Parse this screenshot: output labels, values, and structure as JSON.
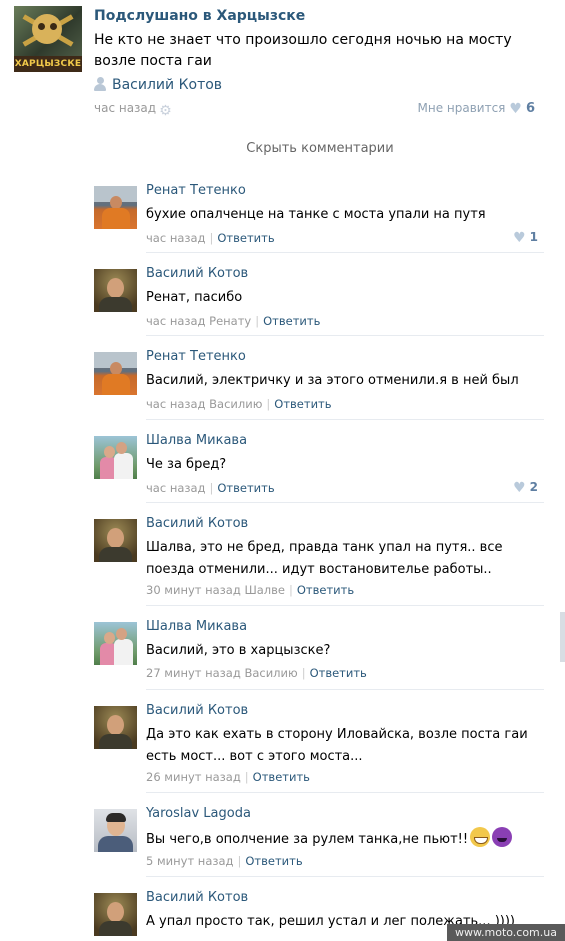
{
  "post": {
    "group_name": "Подслушано в Харцызске",
    "group_avatar_label": "ХАРЦЫЗСКЕ",
    "text": "Не кто не знает что произошло сегодня ночью на мосту возле поста гаи",
    "author": "Василий Котов",
    "time": "час назад",
    "like_label": "Мне нравится",
    "like_count": "6"
  },
  "hide_comments": "Скрыть комментарии",
  "comments": [
    {
      "name": "Ренат Тетенко",
      "text": "бухие опалченце на танке с моста упали на путя",
      "time": "час назад",
      "reply": "Ответить",
      "likes": "1"
    },
    {
      "name": "Василий Котов",
      "text": "Ренат, пасибо",
      "time": "час назад Ренату",
      "reply": "Ответить"
    },
    {
      "name": "Ренат Тетенко",
      "text": "Василий, электричку и за этого отменили.я в ней был",
      "time": "час назад Василию",
      "reply": "Ответить"
    },
    {
      "name": "Шалва Микава",
      "text": "Че за бред?",
      "time": "час назад",
      "reply": "Ответить",
      "likes": "2"
    },
    {
      "name": "Василий Котов",
      "text": "Шалва, это не бред, правда танк упал на путя.. все поезда отменили... идут востановителье работы..",
      "time": "30 минут назад Шалве",
      "reply": "Ответить"
    },
    {
      "name": "Шалва Микава",
      "text": "Василий, это в харцызске?",
      "time": "27 минут назад Василию",
      "reply": "Ответить"
    },
    {
      "name": "Василий Котов",
      "text": "Да это как ехать в сторону Иловайска, возле поста гаи есть мост... вот с этого моста...",
      "time": "26 минут назад",
      "reply": "Ответить"
    },
    {
      "name": "Yaroslav Lagoda",
      "text": "Вы чего,в ополчение за рулем танка,не пьют!!",
      "time": "5 минут назад",
      "reply": "Ответить"
    },
    {
      "name": "Василий Котов",
      "text": "А упал просто так, решил устал и лег полежать... ))))"
    }
  ],
  "icons": {
    "gear": "gear-icon",
    "heart": "heart-icon",
    "person": "person-icon",
    "emoji_1": "grinning-face-icon",
    "emoji_2": "smiling-devil-icon"
  },
  "colors": {
    "link_blue": "#2b587a",
    "meta_gray": "#999999",
    "like_blue": "#5f7fa2"
  },
  "watermark": "www.moto.com.ua"
}
